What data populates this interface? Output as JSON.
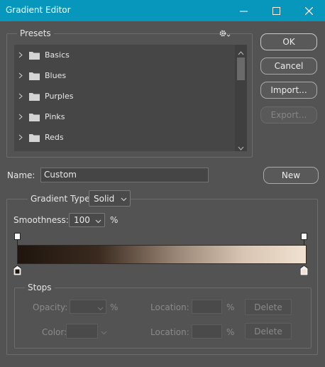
{
  "window": {
    "title": "Gradient Editor",
    "controls": {
      "minimize_icon": "minimize-icon",
      "maximize_icon": "maximize-icon",
      "close_icon": "close-icon"
    }
  },
  "presets": {
    "legend": "Presets",
    "menu_icon": "gear-icon",
    "items": [
      {
        "label": "Basics"
      },
      {
        "label": "Blues"
      },
      {
        "label": "Purples"
      },
      {
        "label": "Pinks"
      },
      {
        "label": "Reds"
      }
    ]
  },
  "buttons": {
    "ok": "OK",
    "cancel": "Cancel",
    "import": "Import...",
    "export": "Export...",
    "new": "New"
  },
  "name": {
    "label": "Name:",
    "value": "Custom"
  },
  "gradient": {
    "type_label": "Gradient Type:",
    "type_value": "Solid",
    "smoothness_label": "Smoothness:",
    "smoothness_value": "100",
    "smoothness_unit": "%",
    "start_color": "#1f150e",
    "end_color": "#f1e2d1"
  },
  "stops": {
    "legend": "Stops",
    "opacity_label": "Opacity:",
    "opacity_unit": "%",
    "color_label": "Color:",
    "location_label": "Location:",
    "location_unit": "%",
    "delete_label": "Delete"
  },
  "colors": {
    "titlebar": "#0797bd",
    "background": "#535353"
  }
}
